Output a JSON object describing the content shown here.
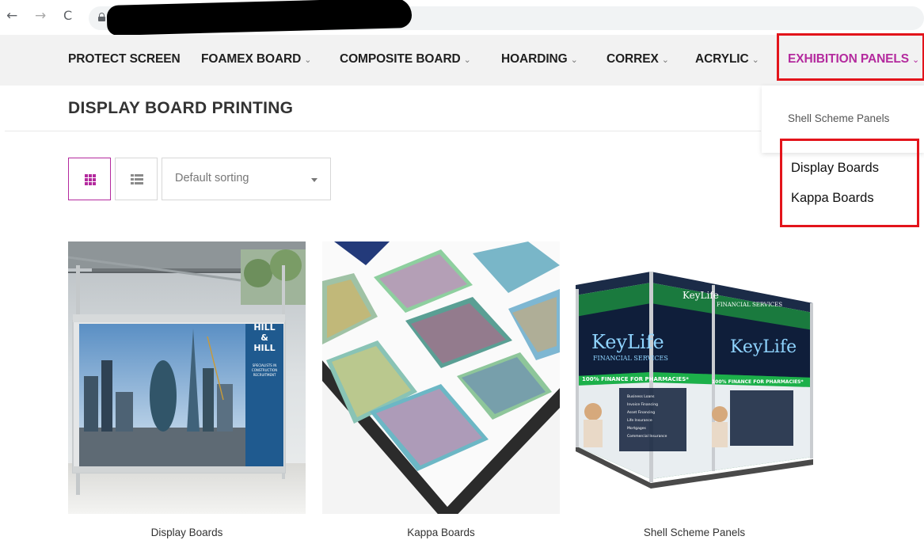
{
  "browser": {
    "back_glyph": "←",
    "forward_glyph": "→",
    "reload_glyph": "C"
  },
  "nav": {
    "items": [
      {
        "label": "PROTECT SCREEN",
        "has_dropdown": false
      },
      {
        "label": "FOAMEX BOARD",
        "has_dropdown": true
      },
      {
        "label": "COMPOSITE BOARD",
        "has_dropdown": true
      },
      {
        "label": "HOARDING",
        "has_dropdown": true
      },
      {
        "label": "CORREX",
        "has_dropdown": true
      },
      {
        "label": "ACRYLIC",
        "has_dropdown": true
      },
      {
        "label": "EXHIBITION PANELS",
        "has_dropdown": true,
        "active": true
      }
    ],
    "chevron": "⌄",
    "accent_color": "#b42a9e"
  },
  "page": {
    "title": "DISPLAY BOARD PRINTING"
  },
  "dropdown": {
    "items": [
      "Shell Scheme Panels"
    ],
    "annotated_items": [
      "Display Boards",
      "Kappa Boards"
    ],
    "annotation_color": "#e3141b"
  },
  "toolbar": {
    "grid_view_icon": "grid-icon",
    "list_view_icon": "list-icon",
    "sort_selected": "Default sorting"
  },
  "products": [
    {
      "name": "Display Boards"
    },
    {
      "name": "Kappa Boards"
    },
    {
      "name": "Shell Scheme Panels"
    }
  ],
  "product_art": {
    "sign_brand": [
      "HILL",
      "&",
      "HILL"
    ],
    "sign_tagline": [
      "SPECIALISTS IN",
      "CONSTRUCTION",
      "RECRUITMENT"
    ],
    "booth_brand": "KeyLife",
    "booth_sub": "FINANCIAL SERVICES",
    "booth_banner": "100% FINANCE FOR PHARMACIES*",
    "booth_list": [
      "Business Loans",
      "Invoice Financing",
      "Asset Financing",
      "Life Insurance",
      "Mortgages",
      "Commercial Insurance"
    ]
  }
}
